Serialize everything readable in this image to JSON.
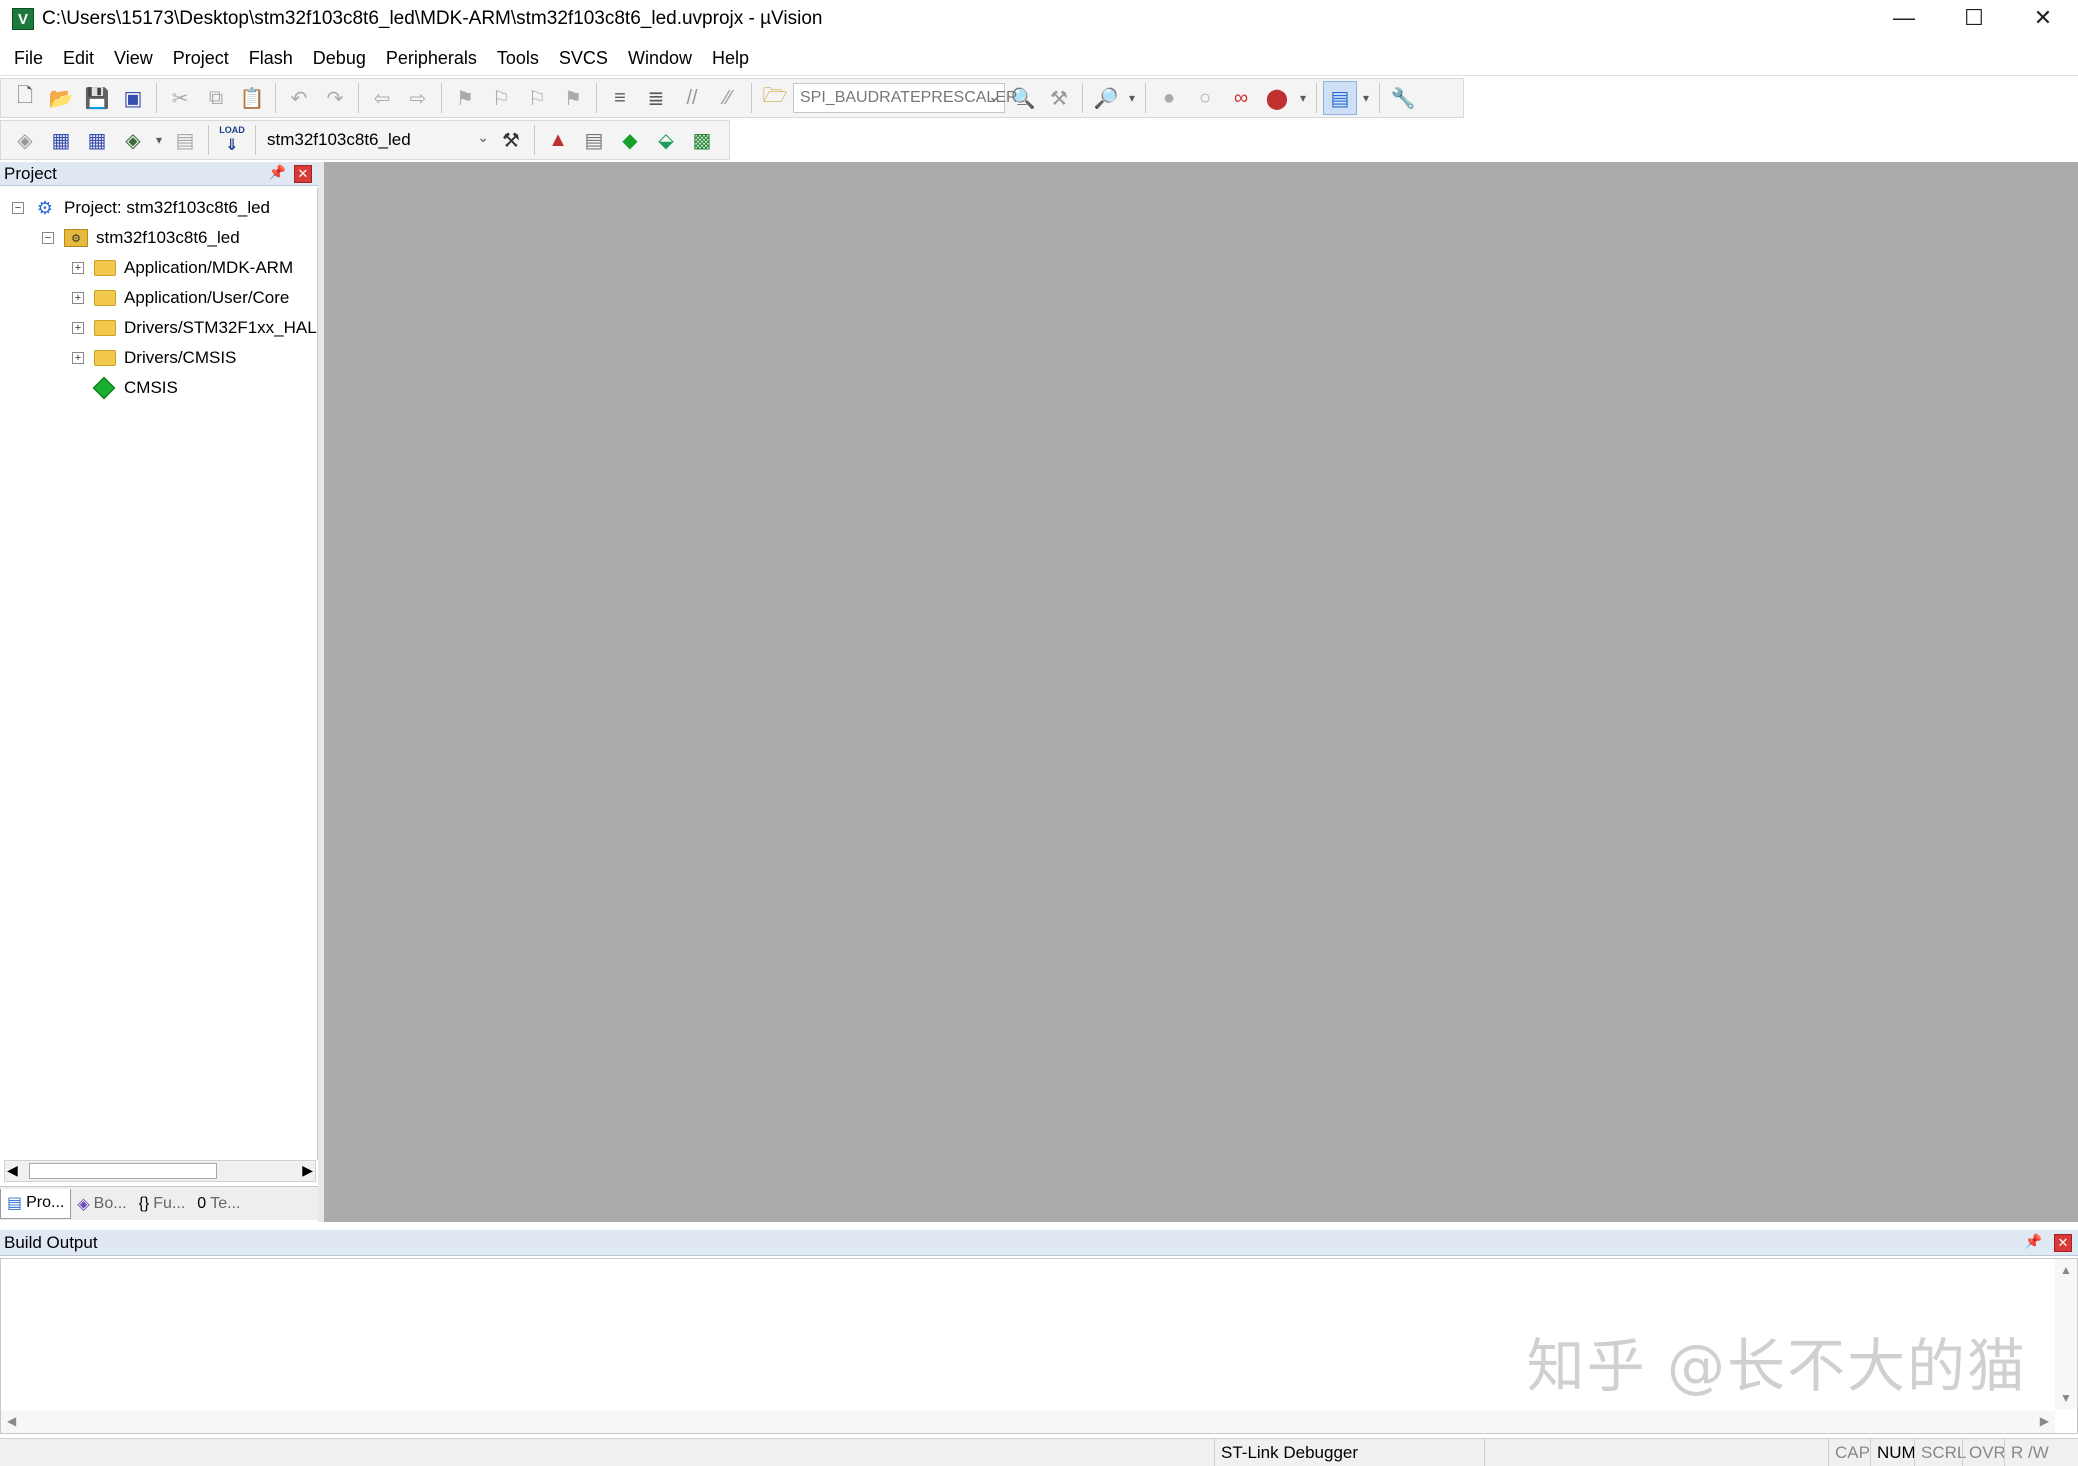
{
  "window": {
    "title": "C:\\Users\\15173\\Desktop\\stm32f103c8t6_led\\MDK-ARM\\stm32f103c8t6_led.uvprojx - µVision",
    "app_icon_letter": "V",
    "min_glyph": "—",
    "max_glyph": "☐",
    "close_glyph": "✕"
  },
  "menu": {
    "items": [
      {
        "label": "File"
      },
      {
        "label": "Edit"
      },
      {
        "label": "View"
      },
      {
        "label": "Project"
      },
      {
        "label": "Flash"
      },
      {
        "label": "Debug"
      },
      {
        "label": "Peripherals"
      },
      {
        "label": "Tools"
      },
      {
        "label": "SVCS"
      },
      {
        "label": "Window"
      },
      {
        "label": "Help"
      }
    ]
  },
  "toolbar": {
    "find_combo_value": "SPI_BAUDRATEPRESCALER_",
    "target_combo_value": "stm32f103c8t6_led",
    "load_label": "LOAD",
    "icons": [
      "new-file-icon",
      "open-file-icon",
      "save-icon",
      "save-all-icon",
      "cut-icon",
      "copy-icon",
      "paste-icon",
      "undo-icon",
      "redo-icon",
      "nav-back-icon",
      "nav-forward-icon",
      "bookmark-icon",
      "indent-icon",
      "comment-icon",
      "find-in-files-icon",
      "debug-session-icon",
      "breakpoint-icon",
      "window-layout-icon",
      "configure-icon"
    ]
  },
  "project_panel": {
    "title": "Project",
    "tree": {
      "root_label": "Project: stm32f103c8t6_led",
      "target_label": "stm32f103c8t6_led",
      "groups": [
        {
          "label": "Application/MDK-ARM"
        },
        {
          "label": "Application/User/Core"
        },
        {
          "label": "Drivers/STM32F1xx_HAL"
        },
        {
          "label": "Drivers/CMSIS"
        }
      ],
      "cmsis_label": "CMSIS"
    },
    "tabs": [
      {
        "label": "Pro..."
      },
      {
        "label": "Bo..."
      },
      {
        "label": "Fu..."
      },
      {
        "label": "Te..."
      }
    ]
  },
  "build_output": {
    "title": "Build Output",
    "watermark": "知乎 @长不大的猫"
  },
  "statusbar": {
    "debugger": "ST-Link Debugger",
    "cap": "CAP",
    "num": "NUM",
    "scrl": "SCRL",
    "ovr": "OVR",
    "rw": "R /W"
  },
  "colors": {
    "editor_background": "#ababab",
    "panel_header": "#dfe8f3",
    "close_red": "#d83a3a",
    "folder_yellow": "#f2c94c",
    "cmsis_green": "#18b02e"
  }
}
